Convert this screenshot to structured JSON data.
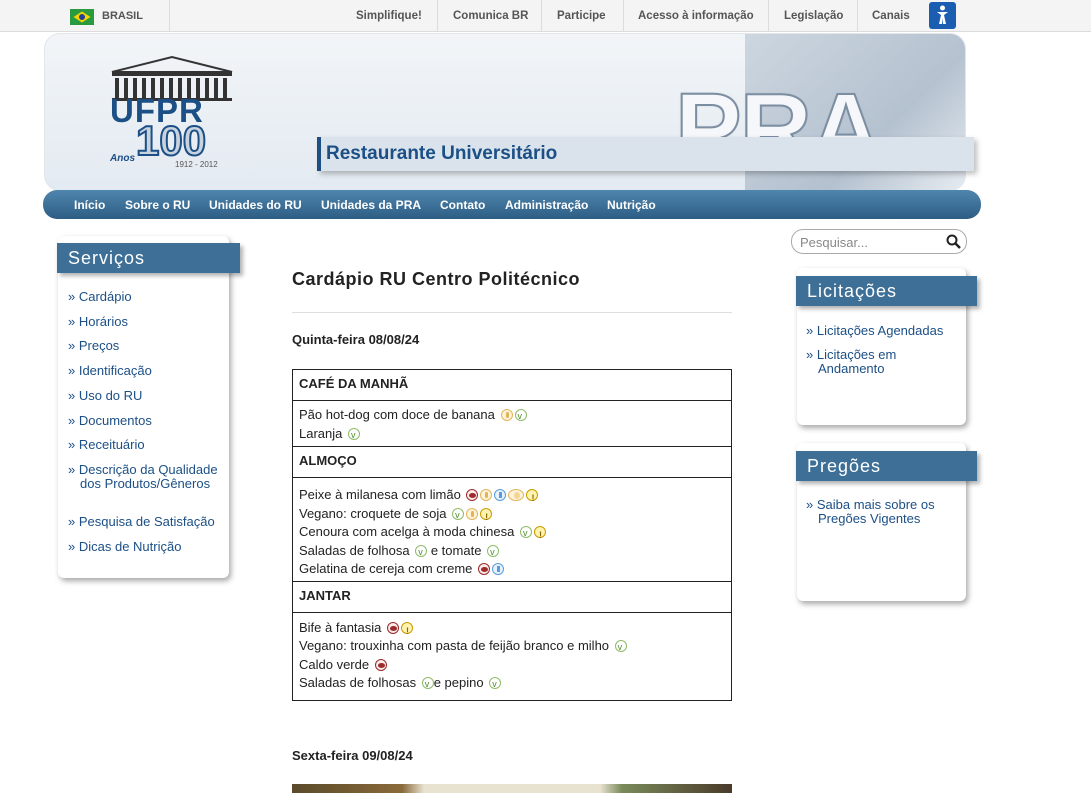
{
  "govbar": {
    "country": "BRASIL",
    "links": [
      "Simplifique!",
      "Comunica BR",
      "Participe",
      "Acesso à informação",
      "Legislação",
      "Canais"
    ]
  },
  "header": {
    "logo_text": "UFPR",
    "anniversary": "100",
    "anos": "Anos",
    "years": "1912 - 2012",
    "brand": "PRA",
    "title": "Restaurante Universitário"
  },
  "nav": [
    "Início",
    "Sobre o RU",
    "Unidades do RU",
    "Unidades da PRA",
    "Contato",
    "Administração",
    "Nutrição"
  ],
  "servicos": {
    "title": "Serviços",
    "items": [
      "Cardápio",
      "Horários",
      "Preços",
      "Identificação",
      "Uso do RU",
      "Documentos",
      "Receituário",
      "Descrição da Qualidade dos Produtos/Gêneros",
      "Pesquisa de Satisfação",
      "Dicas de Nutrição"
    ]
  },
  "search": {
    "placeholder": "Pesquisar..."
  },
  "licitacoes": {
    "title": "Licitações",
    "items": [
      "Licitações Agendadas",
      "Licitações em Andamento"
    ]
  },
  "pregoes": {
    "title": "Pregões",
    "items": [
      "Saiba mais sobre os Pregões Vigentes"
    ]
  },
  "content": {
    "title": "Cardápio RU Centro Politécnico",
    "day1": "Quinta-feira 08/08/24",
    "cafe": "CAFÉ DA MANHÃ",
    "cafe_items": [
      "Pão hot-dog com doce de banana",
      "Laranja"
    ],
    "almoco": "ALMOÇO",
    "almoco_items": [
      "Peixe à milanesa com limão",
      "Vegano: croquete de soja",
      "Cenoura com acelga à moda chinesa",
      "Saladas de folhosa",
      "e tomate",
      "Gelatina de cereja com creme"
    ],
    "jantar": "JANTAR",
    "jantar_items": [
      "Bife à fantasia",
      "Vegano: trouxinha com pasta de feijão branco e milho",
      "Caldo verde",
      "Saladas de folhosas",
      "e pepino"
    ],
    "day2": "Sexta-feira 09/08/24"
  },
  "colors": {
    "nav": "#2d5d85",
    "ribbon": "#3d6f97",
    "link": "#1b4f86"
  }
}
